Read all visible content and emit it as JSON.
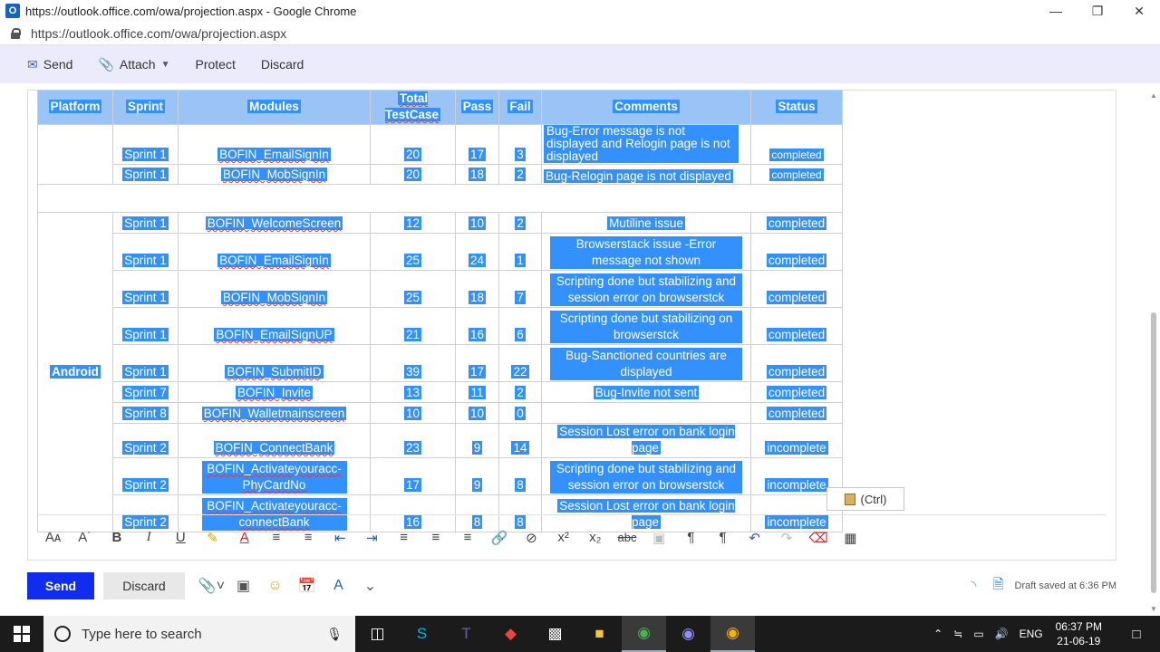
{
  "window": {
    "title": "https://outlook.office.com/owa/projection.aspx - Google Chrome",
    "url": "https://outlook.office.com/owa/projection.aspx",
    "app_icon": "O"
  },
  "commands": {
    "send": "Send",
    "attach": "Attach",
    "protect": "Protect",
    "discard": "Discard"
  },
  "table": {
    "top_rows": [
      {
        "sprint": "Sprint 1",
        "module": "BOFIN_EmailSignIn",
        "total": "20",
        "pass": "17",
        "fail": "3",
        "comments": "Bug-Error message is not displayed and Relogin page is not displayed",
        "status": "completed"
      },
      {
        "sprint": "Sprint 1",
        "module": "BOFIN_MobSignIn",
        "total": "20",
        "pass": "18",
        "fail": "2",
        "comments": "Bug-Relogin page is not displayed",
        "status": "completed"
      }
    ],
    "headers": [
      "Platform",
      "Sprint",
      "Modules",
      "Total TestCase",
      "Pass",
      "Fail",
      "Comments",
      "Status"
    ],
    "platform": "Android",
    "rows": [
      {
        "sprint": "Sprint 1",
        "module": "BOFIN_WelcomeScreen",
        "total": "12",
        "pass": "10",
        "fail": "2",
        "comments": "Mutiline issue",
        "status": "completed"
      },
      {
        "sprint": "Sprint 1",
        "module": "BOFIN_EmailSignIn",
        "total": "25",
        "pass": "24",
        "fail": "1",
        "comments": "Browserstack issue -Error message not shown",
        "status": "completed"
      },
      {
        "sprint": "Sprint 1",
        "module": "BOFIN_MobSignIn",
        "total": "25",
        "pass": "18",
        "fail": "7",
        "comments": "Scripting done but stabilizing and session error on browserstck",
        "status": "completed"
      },
      {
        "sprint": "Sprint 1",
        "module": "BOFIN_EmailSignUP",
        "total": "21",
        "pass": "16",
        "fail": "6",
        "comments": "Scripting done but stabilizing on browserstck",
        "status": "completed"
      },
      {
        "sprint": "Sprint 1",
        "module": "BOFIN_SubmitID",
        "total": "39",
        "pass": "17",
        "fail": "22",
        "comments": "Bug-Sanctioned countries are displayed",
        "status": "completed"
      },
      {
        "sprint": "Sprint 7",
        "module": "BOFIN_Invite",
        "total": "13",
        "pass": "11",
        "fail": "2",
        "comments": "Bug-Invite not sent",
        "status": "completed"
      },
      {
        "sprint": "Sprint 8",
        "module": "BOFIN_Walletmainscreen",
        "total": "10",
        "pass": "10",
        "fail": "0",
        "comments": "",
        "status": "completed"
      },
      {
        "sprint": "Sprint 2",
        "module": "BOFIN_ConnectBank",
        "total": "23",
        "pass": "9",
        "fail": "14",
        "comments": "Session Lost error on bank login page",
        "status": "incomplete"
      },
      {
        "sprint": "Sprint 2",
        "module": "BOFIN_Activateyouracc-PhyCardNo",
        "total": "17",
        "pass": "9",
        "fail": "8",
        "comments": "Scripting done but stabilizing and session error on browserstck",
        "status": "incomplete"
      },
      {
        "sprint": "Sprint 2",
        "module": "BOFIN_Activateyouracc-connectBank",
        "total": "16",
        "pass": "8",
        "fail": "8",
        "comments": "Session Lost error on bank login page",
        "status": "incomplete"
      }
    ]
  },
  "paste_option": "(Ctrl)",
  "bottom": {
    "send": "Send",
    "discard": "Discard",
    "draft_status": "Draft saved at 6:36 PM"
  },
  "taskbar": {
    "search_placeholder": "Type here to search",
    "language": "ENG",
    "time": "06:37 PM",
    "date": "21-06-19"
  },
  "colors": {
    "selection": "#3390ff",
    "header_bg": "#99c4f5",
    "send_button": "#0f2cef",
    "command_bar": "#ecebfb"
  }
}
